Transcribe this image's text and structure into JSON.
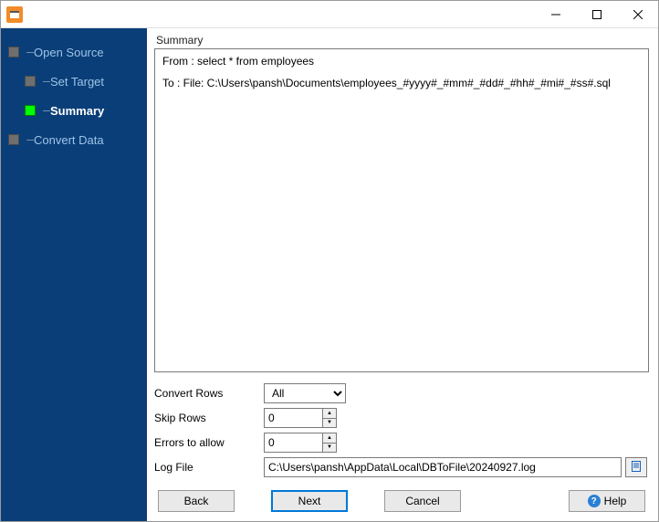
{
  "sidebar": {
    "items": [
      {
        "label": "Open Source",
        "active": false,
        "sub": false
      },
      {
        "label": "Set Target",
        "active": false,
        "sub": true
      },
      {
        "label": "Summary",
        "active": true,
        "sub": true
      },
      {
        "label": "Convert Data",
        "active": false,
        "sub": false
      }
    ]
  },
  "section": {
    "title": "Summary"
  },
  "summary": {
    "from": "From : select * from employees",
    "to": "To : File: C:\\Users\\pansh\\Documents\\employees_#yyyy#_#mm#_#dd#_#hh#_#mi#_#ss#.sql"
  },
  "form": {
    "convert_rows_label": "Convert Rows",
    "convert_rows_value": "All",
    "skip_rows_label": "Skip Rows",
    "skip_rows_value": "0",
    "errors_label": "Errors to allow",
    "errors_value": "0",
    "logfile_label": "Log File",
    "logfile_value": "C:\\Users\\pansh\\AppData\\Local\\DBToFile\\20240927.log"
  },
  "buttons": {
    "back": "Back",
    "next": "Next",
    "cancel": "Cancel",
    "help": "Help"
  }
}
